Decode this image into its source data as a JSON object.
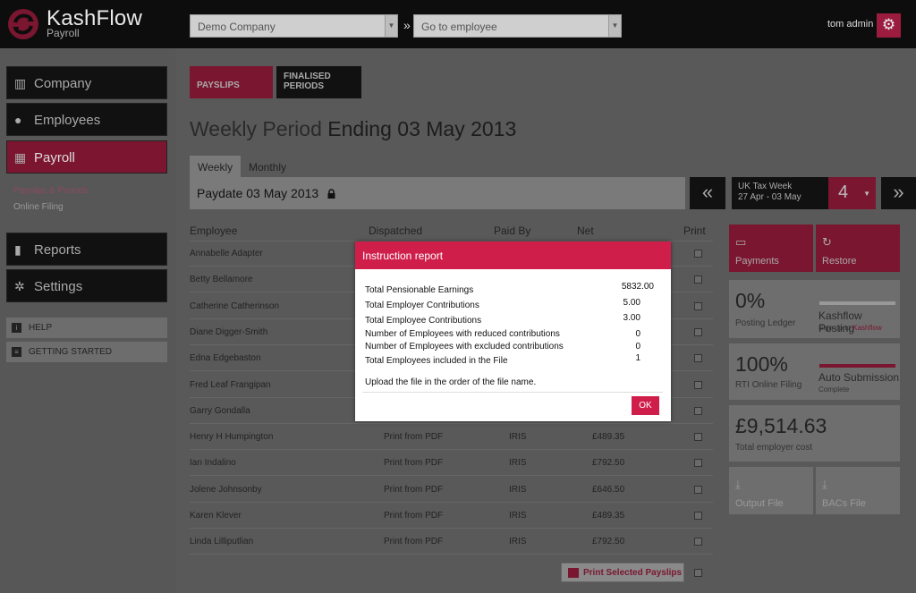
{
  "header": {
    "brand": "KashFlow",
    "brand_sub": "Payroll",
    "company_select": "Demo Company",
    "separator": "»",
    "employee_select": "Go to employee",
    "user": "tom admin",
    "icons": {
      "logo": "kashflow-logo-icon",
      "settings": "gear-icon",
      "caret": "chevron-down-icon"
    }
  },
  "sidebar": {
    "items": [
      {
        "label": "Company",
        "icon": "building-icon"
      },
      {
        "label": "Employees",
        "icon": "user-icon"
      },
      {
        "label": "Payroll",
        "icon": "calculator-icon"
      }
    ],
    "sub_links": [
      "Payslips & Periods",
      "Online Filing"
    ],
    "items2": [
      {
        "label": "Reports",
        "icon": "bar-chart-icon"
      },
      {
        "label": "Settings",
        "icon": "cogs-icon"
      }
    ],
    "help": [
      "HELP",
      "GETTING STARTED"
    ]
  },
  "main": {
    "tabs": [
      "PAYSLIPS",
      "FINALISED PERIODS"
    ],
    "title_prefix": "Weekly Period",
    "title_main": "Ending 03 May 2013",
    "period_tabs": [
      "Weekly",
      "Monthly"
    ],
    "paydate": "Paydate 03 May 2013",
    "prev": "«",
    "next": "»",
    "tax_week_label": "UK Tax Week",
    "tax_week_range": "27 Apr - 03 May",
    "week_number": "4",
    "columns": [
      "Employee",
      "Dispatched",
      "Paid By",
      "Net",
      "Print"
    ],
    "rows": [
      {
        "name": "Annabelle Adapter",
        "dispatched": "",
        "paid": "",
        "net": ""
      },
      {
        "name": "Betty Bellamore",
        "dispatched": "",
        "paid": "",
        "net": ""
      },
      {
        "name": "Catherine Catherinson",
        "dispatched": "",
        "paid": "",
        "net": ""
      },
      {
        "name": "Diane Digger-Smith",
        "dispatched": "",
        "paid": "",
        "net": ""
      },
      {
        "name": "Edna Edgebaston",
        "dispatched": "",
        "paid": "",
        "net": ""
      },
      {
        "name": "Fred Leaf Frangipan",
        "dispatched": "",
        "paid": "",
        "net": ""
      },
      {
        "name": "Garry Gondalla",
        "dispatched": "",
        "paid": "",
        "net": ""
      },
      {
        "name": "Henry H Humpington",
        "dispatched": "Print from PDF",
        "paid": "IRIS",
        "net": "£489.35"
      },
      {
        "name": "Ian Indalino",
        "dispatched": "Print from PDF",
        "paid": "IRIS",
        "net": "£792.50"
      },
      {
        "name": "Jolene Johnsonby",
        "dispatched": "Print from PDF",
        "paid": "IRIS",
        "net": "£646.50"
      },
      {
        "name": "Karen Klever",
        "dispatched": "Print from PDF",
        "paid": "IRIS",
        "net": "£489.35"
      },
      {
        "name": "Linda Lilliputlian",
        "dispatched": "Print from PDF",
        "paid": "IRIS",
        "net": "£792.50"
      }
    ],
    "print_button": "Print Selected Payslips"
  },
  "right": {
    "payments": "Payments",
    "restore": "Restore",
    "posting_pct": "0%",
    "posting_label": "Posting Ledger",
    "kf_posting": "Kashflow Posting",
    "kf_signup": "Sign up to",
    "kf_link": "Kashflow",
    "posting_progress": 0,
    "rti_pct": "100%",
    "rti_label": "RTI Online Filing",
    "auto_sub": "Auto Submission",
    "auto_complete": "Complete",
    "rti_progress": 1,
    "total_cost": "£9,514.63",
    "total_cost_label": "Total employer cost",
    "output_file": "Output File",
    "bacs_file": "BACs File"
  },
  "modal": {
    "title": "Instruction report",
    "rows": [
      {
        "label": "Total Pensionable Earnings",
        "value": "5832.00"
      },
      {
        "label": "Total Employer Contributions",
        "value": "5.00"
      },
      {
        "label": "Total Employee Contributions",
        "value": "3.00"
      },
      {
        "label": "Number of Employees with reduced contributions",
        "value": "0"
      },
      {
        "label": "Number of Employees with excluded contributions",
        "value": "0"
      },
      {
        "label": "Total Employees included in the File",
        "value": "1"
      }
    ],
    "note": "Upload the file in the order of the file name.",
    "ok": "OK"
  },
  "colors": {
    "brand_red": "#d01e4b",
    "dim_red": "#7a1630"
  }
}
